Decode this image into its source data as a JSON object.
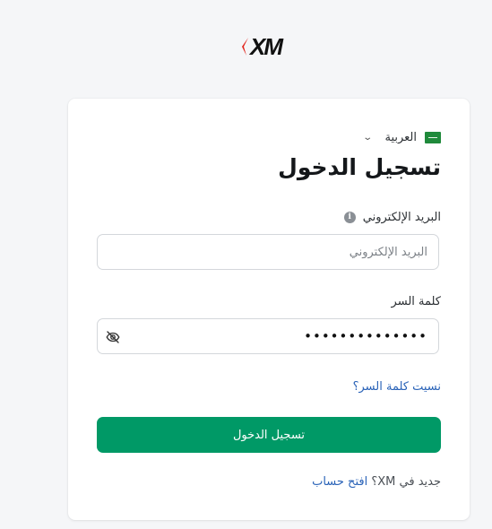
{
  "brand": {
    "logo_text": "XM",
    "accent_color": "#e2231a"
  },
  "language": {
    "selected": "العربية",
    "flag_icon": "saudi-arabia-flag-icon",
    "chevron_icon": "chevron-down-icon"
  },
  "login": {
    "title": "تسجيل الدخول",
    "email_label": "البريد الإلكتروني",
    "email_placeholder": "البريد الإلكتروني",
    "email_value": "",
    "password_label": "كلمة السر",
    "password_masked": "••••••••••••••",
    "forgot_link": "نسيت كلمة السر؟",
    "submit_label": "تسجيل الدخول",
    "submit_color": "#009966",
    "signup_prompt": "جديد في XM؟",
    "signup_link": "افتح حساب"
  }
}
